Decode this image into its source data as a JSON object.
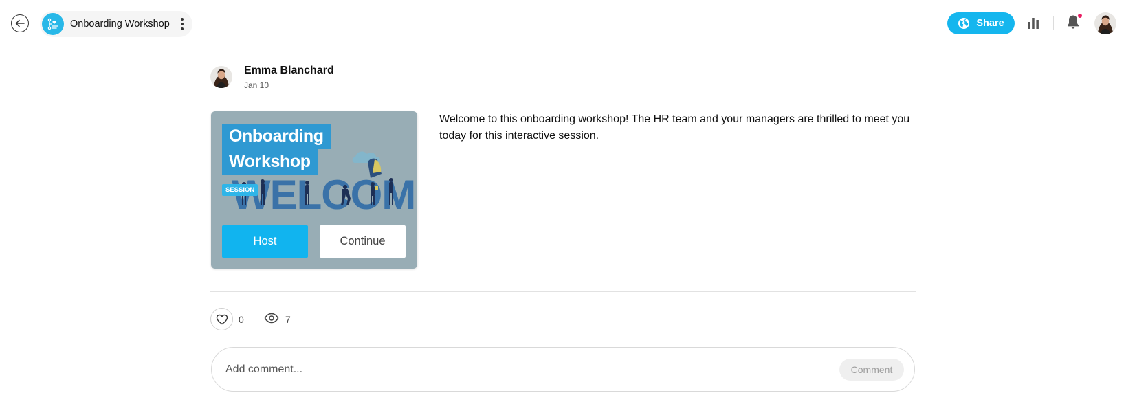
{
  "header": {
    "title": "Onboarding Workshop",
    "share_label": "Share"
  },
  "post": {
    "author": "Emma Blanchard",
    "date": "Jan 10",
    "description": "Welcome to this onboarding workshop! The HR team and your managers are thrilled to meet you today for this interactive session."
  },
  "card": {
    "title_line1": "Onboarding",
    "title_line2": "Workshop",
    "badge": "SESSION",
    "background_word": "WELCOME",
    "host_label": "Host",
    "continue_label": "Continue"
  },
  "stats": {
    "likes": "0",
    "views": "7"
  },
  "comment": {
    "placeholder": "Add comment...",
    "button_label": "Comment"
  },
  "icons": {
    "back": "arrow-left-icon",
    "app": "workflow-icon",
    "share": "globe-icon",
    "stats": "bar-chart-icon",
    "notifications": "bell-icon",
    "like": "heart-icon",
    "views": "eye-icon"
  },
  "colors": {
    "accent": "#15b6ee",
    "card_bg": "#98adb5",
    "title_bg": "#2f99d2",
    "notification_dot": "#e91e63"
  }
}
